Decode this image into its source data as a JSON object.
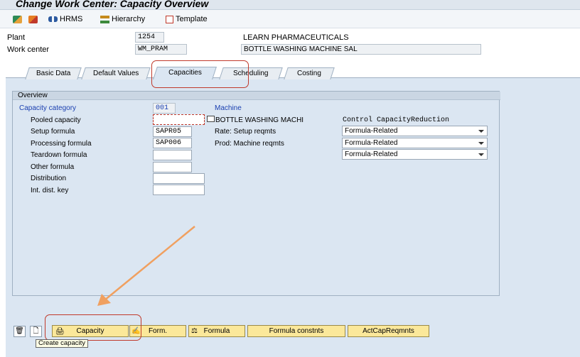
{
  "window": {
    "title": "Change Work Center: Capacity Overview"
  },
  "toolbar": {
    "hrms_label": "HRMS",
    "hierarchy_label": "Hierarchy",
    "template_label": "Template"
  },
  "header": {
    "plant_label": "Plant",
    "plant_value": "1254",
    "plant_desc": "LEARN PHARMACEUTICALS",
    "workcenter_label": "Work center",
    "workcenter_value": "WM_PRAM",
    "workcenter_desc": "BOTTLE WASHING MACHINE SAL"
  },
  "tabs": [
    {
      "label": "Basic Data"
    },
    {
      "label": "Default Values"
    },
    {
      "label": "Capacities"
    },
    {
      "label": "Scheduling"
    },
    {
      "label": "Costing"
    }
  ],
  "overview": {
    "title": "Overview",
    "capacity_category_label": "Capacity category",
    "capacity_category_value": "001",
    "capacity_category_desc": "Machine",
    "pooled_capacity_label": "Pooled capacity",
    "pooled_capacity_value": "",
    "capacity_desc": "BOTTLE WASHING MACHI",
    "control_header": "Control CapacityReduction",
    "setup_formula_label": "Setup formula",
    "setup_formula_value": "SAPR05",
    "setup_formula_desc": "Rate: Setup reqmts",
    "processing_formula_label": "Processing formula",
    "processing_formula_value": "SAP006",
    "processing_formula_desc": "Prod: Machine reqmts",
    "teardown_formula_label": "Teardown formula",
    "teardown_formula_value": "",
    "other_formula_label": "Other formula",
    "other_formula_value": "",
    "distribution_label": "Distribution",
    "distribution_value": "",
    "int_dist_key_label": "Int. dist. key",
    "int_dist_key_value": "",
    "dropdowns": [
      {
        "selected": "Formula-Related"
      },
      {
        "selected": "Formula-Related"
      },
      {
        "selected": "Formula-Related"
      }
    ]
  },
  "bottom_buttons": {
    "capacity": "Capacity",
    "form": "Form.",
    "formula": "Formula",
    "formula_constnts": "Formula constnts",
    "actcapreqmnts": "ActCapReqmnts"
  },
  "tooltip": {
    "text": "Create capacity"
  },
  "colors": {
    "annotation_red": "#c0392b",
    "annotation_arrow": "#f0a060",
    "panel_bg": "#dbe6f2",
    "button_yellow": "#fbe89a"
  }
}
